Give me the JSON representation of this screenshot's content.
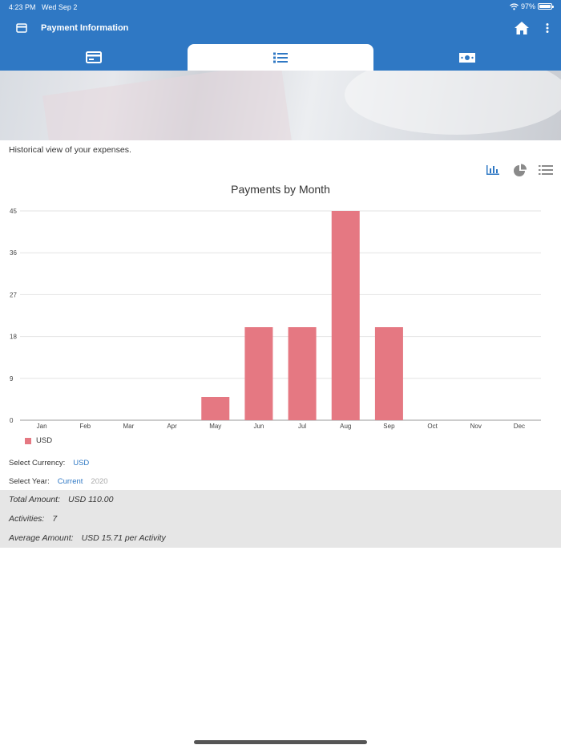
{
  "status_bar": {
    "time": "4:23 PM",
    "date": "Wed Sep 2",
    "battery": "97%",
    "battery_level": 0.97
  },
  "header": {
    "title": "Payment Information",
    "background_color": "#2f78c4"
  },
  "tabs": [
    {
      "icon": "credit-card-icon",
      "selected": false
    },
    {
      "icon": "list-icon",
      "selected": true
    },
    {
      "icon": "money-icon",
      "selected": false
    }
  ],
  "page": {
    "subtitle": "Historical view of your expenses."
  },
  "view_toggles": [
    {
      "icon": "bar-chart-icon",
      "active": true
    },
    {
      "icon": "pie-chart-icon",
      "active": false
    },
    {
      "icon": "list-view-icon",
      "active": false
    }
  ],
  "chart_data": {
    "type": "bar",
    "title": "Payments by Month",
    "categories": [
      "Jan",
      "Feb",
      "Mar",
      "Apr",
      "May",
      "Jun",
      "Jul",
      "Aug",
      "Sep",
      "Oct",
      "Nov",
      "Dec"
    ],
    "series": [
      {
        "name": "USD",
        "values": [
          0,
          0,
          0,
          0,
          5,
          20,
          20,
          45,
          20,
          0,
          0,
          0
        ],
        "color": "#e57882"
      }
    ],
    "yticks": [
      0,
      9,
      18,
      27,
      36,
      45
    ],
    "ylim": [
      0,
      45
    ],
    "grid": true,
    "legend": "bottom-left"
  },
  "filters": {
    "currency_label": "Select Currency:",
    "currency_value": "USD",
    "year_label": "Select Year:",
    "year_current": "Current",
    "year_other": "2020"
  },
  "summary": {
    "total_label": "Total Amount:",
    "total_value": "USD 110.00",
    "activities_label": "Activities:",
    "activities_value": "7",
    "average_label": "Average Amount:",
    "average_value": "USD 15.71 per Activity"
  }
}
